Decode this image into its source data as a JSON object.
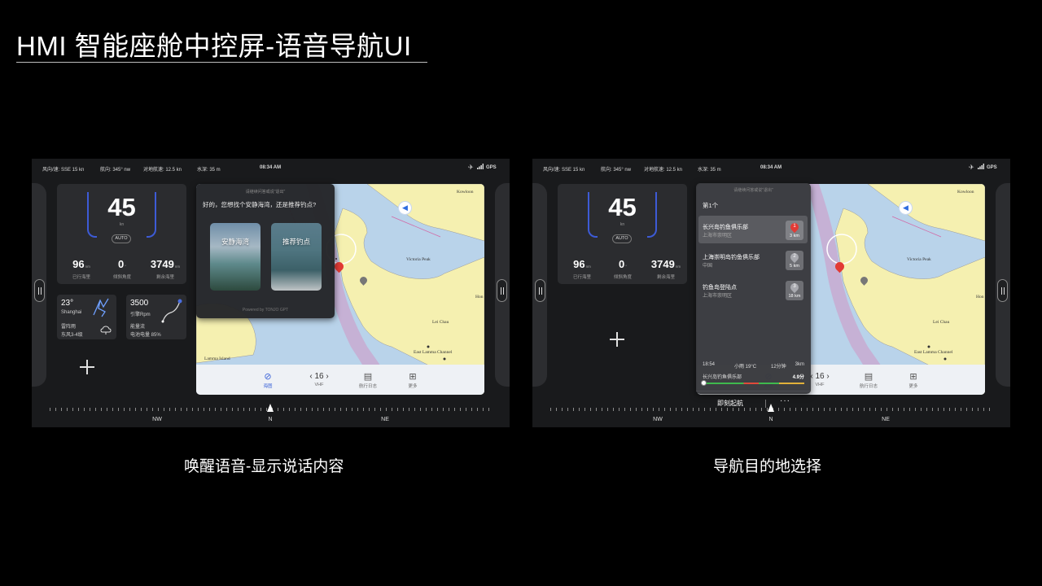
{
  "page": {
    "title": "HMI 智能座舱中控屏-语音导航UI"
  },
  "status": {
    "wind": "风向/速: SSE 15 kn",
    "heading": "航向: 345° nw",
    "sog": "对地航速: 12.5 kn",
    "depth": "水深: 35 m",
    "time": "08:34 AM",
    "gps": "GPS"
  },
  "dashboard": {
    "speed": "45",
    "speed_unit": "kn",
    "mode": "AUTO",
    "stats": [
      {
        "value": "96",
        "unit": "nm",
        "label": "已行海里"
      },
      {
        "value": "0",
        "unit": "°",
        "label": "倾斜角度"
      },
      {
        "value": "3749",
        "unit": "nm",
        "label": "剩余海里"
      }
    ]
  },
  "weather": {
    "temp": "23°",
    "city": "Shanghai",
    "condition": "雷阵雨",
    "wind": "东风3-4级",
    "icon": "lightning-icon"
  },
  "power": {
    "rpm": "3500",
    "rpm_label": "引擎Rpm",
    "energy": "能量流",
    "battery": "电池电量 85%"
  },
  "map": {
    "labels": {
      "kowloon": "Kowloon",
      "peak": "Victoria Peak",
      "leichau": "Lei Chau",
      "channel": "East Lamma Channel",
      "lamma": "Lamma Island",
      "hong": "Hon"
    }
  },
  "nav": {
    "channel": "16",
    "items": [
      {
        "label": "海图",
        "icon": "compass-icon"
      },
      {
        "label": "VHF",
        "icon": "radio-icon"
      },
      {
        "label": "航行日志",
        "icon": "logbook-icon"
      },
      {
        "label": "更多",
        "icon": "grid-icon"
      }
    ]
  },
  "compass": {
    "nw": "NW",
    "n": "N",
    "ne": "NE"
  },
  "voice": {
    "hint": "请继续问答或说\"退出\"",
    "speech": "好的，您想找个安静海湾，还是推荐钓点?",
    "choices": [
      "安静海湾",
      "推荐钓点"
    ],
    "powered": "Powered by TONJO GPT"
  },
  "destinations": {
    "hint": "请继续问答或说\"退出\"",
    "count": "第1个",
    "items": [
      {
        "name": "长兴岛钓鱼俱乐部",
        "sub": "上海市崇明区",
        "num": "1",
        "dist": "3 km"
      },
      {
        "name": "上海崇明岛钓鱼俱乐部",
        "sub": "中国",
        "num": "2",
        "dist": "5 km"
      },
      {
        "name": "钓鱼岛登陆点",
        "sub": "上海市崇明区",
        "num": "3",
        "dist": "18 km"
      }
    ],
    "route": {
      "eta": "18:54",
      "weather": "小雨 19°C",
      "duration": "12分钟",
      "distance": "3km",
      "name": "长兴岛钓鱼俱乐部",
      "score": "4.9分"
    },
    "go": "即刻起航",
    "more": "···"
  },
  "captions": {
    "left": "唤醒语音-显示说话内容",
    "right": "导航目的地选择"
  },
  "colors": {
    "accent": "#3a62d8",
    "gauge": "#3d5bd6",
    "marker": "#e23a35"
  }
}
